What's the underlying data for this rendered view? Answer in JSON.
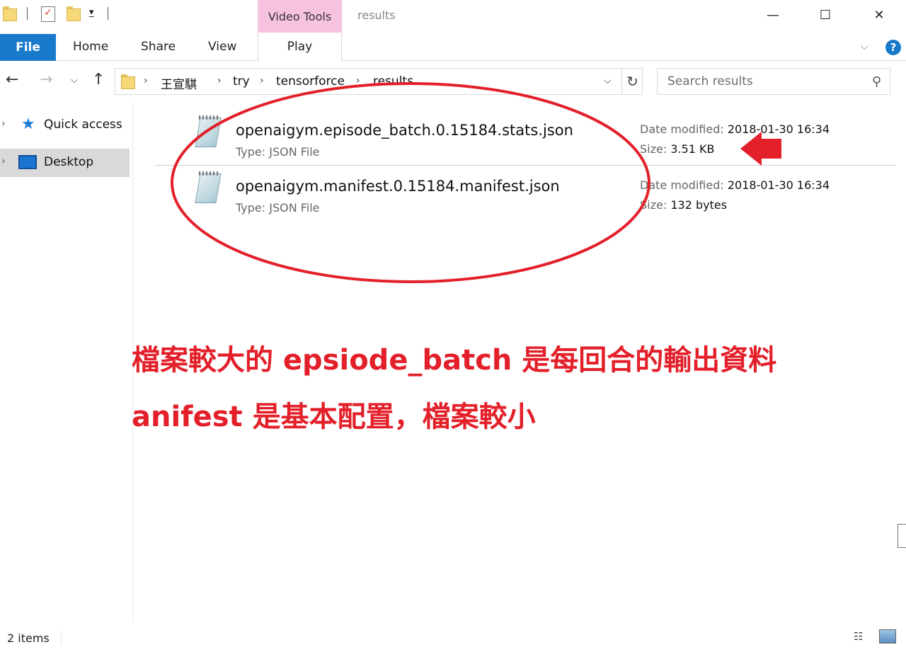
{
  "window": {
    "title": "results",
    "context_tab_group": "Video Tools",
    "min_icon": "minimize-icon",
    "max_icon": "maximize-icon",
    "close_icon": "close-icon"
  },
  "ribbon": {
    "tabs": [
      "File",
      "Home",
      "Share",
      "View",
      "Play"
    ],
    "file_color": "#1979ca",
    "context_color": "#f7c2dd"
  },
  "address": {
    "crumbs": [
      "王宣騏",
      "try",
      "tensorforce",
      "results"
    ]
  },
  "search": {
    "placeholder": "Search results"
  },
  "nav": {
    "items": [
      {
        "label": "Quick access",
        "icon": "star-icon"
      },
      {
        "label": "Desktop",
        "icon": "desktop-icon"
      }
    ]
  },
  "files": [
    {
      "name": "openaigym.episode_batch.0.15184.stats.json",
      "type": "Type: JSON File",
      "modified_label": "Date modified: ",
      "modified": "2018-01-30 16:34",
      "size_label": "Size: ",
      "size": "3.51 KB"
    },
    {
      "name": "openaigym.manifest.0.15184.manifest.json",
      "type": "Type: JSON File",
      "modified_label": "Date modified: ",
      "modified": "2018-01-30 16:34",
      "size_label": "Size: ",
      "size": "132 bytes"
    }
  ],
  "annotation": {
    "color": "#e3202a",
    "line1": "檔案較大的 epsiode_batch 是每回合的輸出資料",
    "line2": "anifest 是基本配置，檔案較小"
  },
  "status": {
    "count": "2 items"
  }
}
